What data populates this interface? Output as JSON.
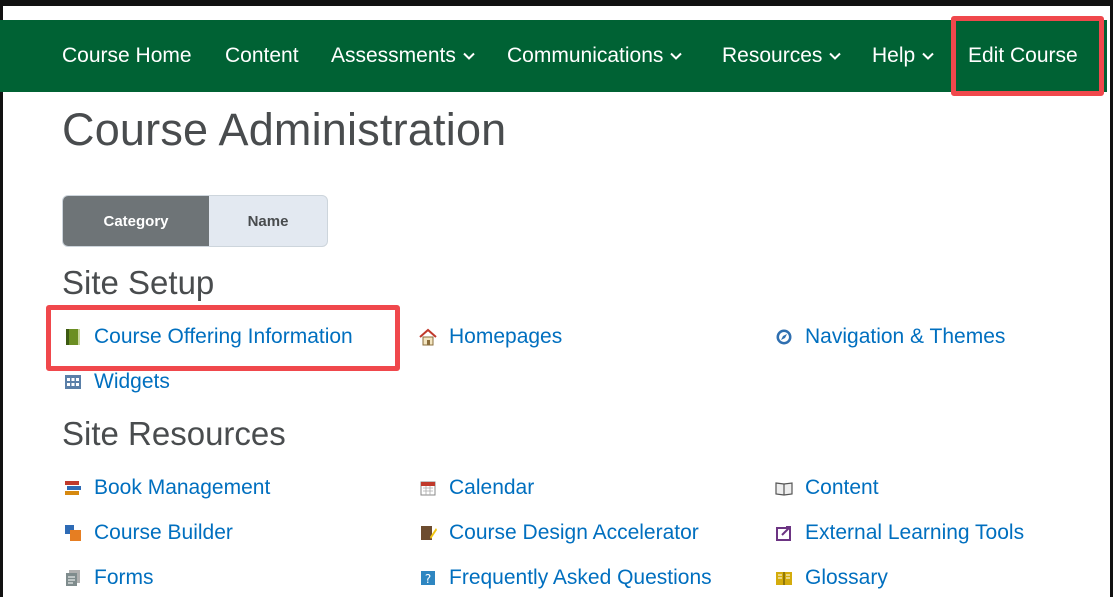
{
  "nav": {
    "course_home": "Course Home",
    "content": "Content",
    "assessments": "Assessments",
    "communications": "Communications",
    "resources": "Resources",
    "help": "Help",
    "edit_course": "Edit Course"
  },
  "page_title": "Course Administration",
  "view_toggle": {
    "category": "Category",
    "name": "Name",
    "selected": "Category"
  },
  "site_setup": {
    "heading": "Site Setup",
    "items": [
      {
        "label": "Course Offering Information",
        "icon": "green-book-icon"
      },
      {
        "label": "Homepages",
        "icon": "house-icon"
      },
      {
        "label": "Navigation & Themes",
        "icon": "compass-icon"
      },
      {
        "label": "Widgets",
        "icon": "widgets-grid-icon"
      }
    ]
  },
  "site_resources": {
    "heading": "Site Resources",
    "items": [
      {
        "label": "Book Management",
        "icon": "books-stack-icon"
      },
      {
        "label": "Calendar",
        "icon": "calendar-icon"
      },
      {
        "label": "Content",
        "icon": "open-book-icon"
      },
      {
        "label": "Course Builder",
        "icon": "blocks-icon"
      },
      {
        "label": "Course Design Accelerator",
        "icon": "book-pencil-icon"
      },
      {
        "label": "External Learning Tools",
        "icon": "external-tool-icon"
      },
      {
        "label": "Forms",
        "icon": "forms-icon"
      },
      {
        "label": "Frequently Asked Questions",
        "icon": "faq-icon"
      },
      {
        "label": "Glossary",
        "icon": "glossary-icon"
      }
    ]
  },
  "colors": {
    "navbar": "#006234",
    "link": "#006fbf",
    "highlight": "#f0484c",
    "heading": "#494c4e"
  }
}
